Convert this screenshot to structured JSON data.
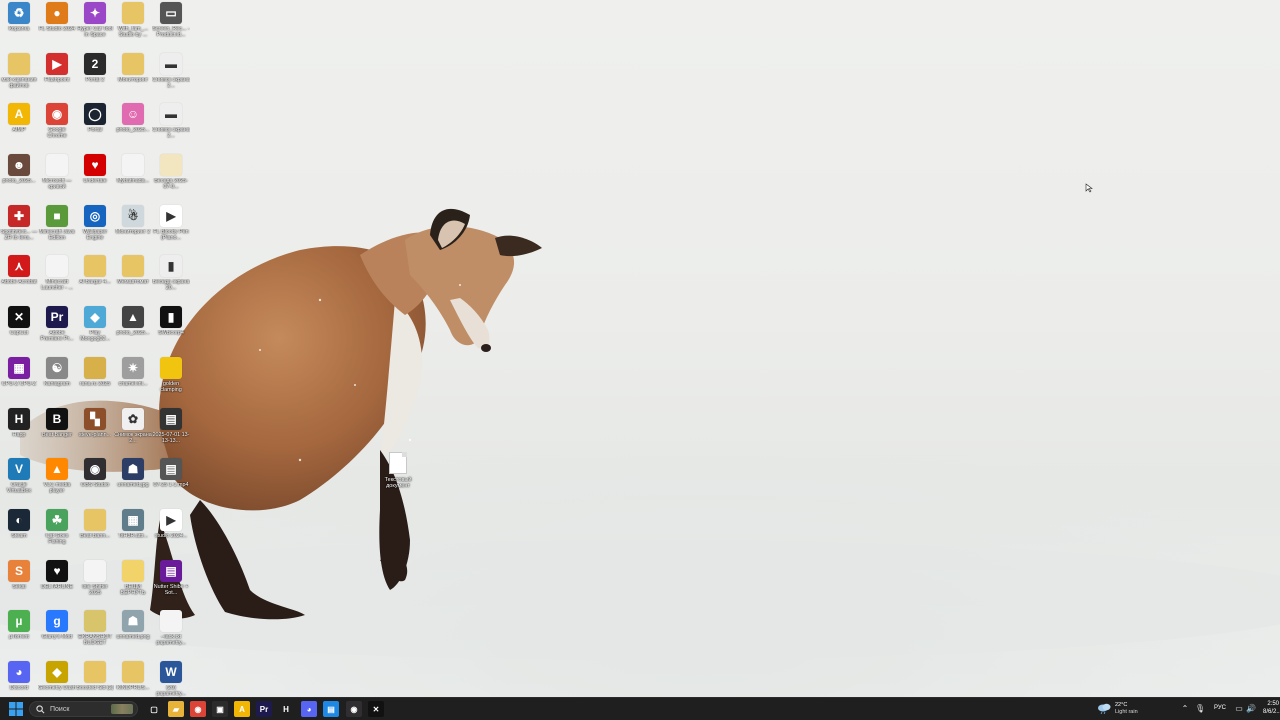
{
  "desktop": {
    "icons": [
      {
        "label": "Корзина",
        "glyph": "♻",
        "color": "#3a86c8"
      },
      {
        "label": "FL Studio 2024",
        "glyph": "●",
        "color": "#e07b1a"
      },
      {
        "label": "Hyper Cat Tool in Space",
        "glyph": "✦",
        "color": "#9b48c8"
      },
      {
        "label": "With_fam_... Studio by ...",
        "glyph": "",
        "color": "#e8c564"
      },
      {
        "label": "Screen_Rec... - Product.ld...",
        "glyph": "▭",
        "color": "#555555"
      },
      {
        "label": "мэй кампания файлов",
        "glyph": "",
        "color": "#e8c564"
      },
      {
        "label": "Flashpoint",
        "glyph": "▶",
        "color": "#d32f2f"
      },
      {
        "label": "Portal 2",
        "glyph": "2",
        "color": "#2b2b2b"
      },
      {
        "label": "Мониторинг",
        "glyph": "",
        "color": "#e8c564"
      },
      {
        "label": "Снимок экрана 2...",
        "glyph": "▬",
        "color": "#eeeeee"
      },
      {
        "label": "AIMP",
        "glyph": "A",
        "color": "#f2b705"
      },
      {
        "label": "Google Chrome",
        "glyph": "◉",
        "color": "#db4437"
      },
      {
        "label": "Portal",
        "glyph": "◯",
        "color": "#1b2430"
      },
      {
        "label": "photo_2025...",
        "glyph": "☺",
        "color": "#e06bb0"
      },
      {
        "label": "Снимок экрана 2...",
        "glyph": "▬",
        "color": "#eeeeee"
      },
      {
        "label": "photo_2025...",
        "glyph": "☻",
        "color": "#6a4a3c"
      },
      {
        "label": "Microsoft — кривой",
        "glyph": "",
        "color": "#f4f4f4"
      },
      {
        "label": "Undertale",
        "glyph": "♥",
        "color": "#d40000"
      },
      {
        "label": "Mybatinada...",
        "glyph": "",
        "color": "#f4f4f4"
      },
      {
        "label": "Беседа 2025-07-0...",
        "glyph": "",
        "color": "#f2e6c0"
      },
      {
        "label": "Spotifytext... — ZR to lens...",
        "glyph": "✚",
        "color": "#c62828"
      },
      {
        "label": "Minecraft Java Edition",
        "glyph": "■",
        "color": "#5a9a3a"
      },
      {
        "label": "Wallpaper Engine",
        "glyph": "◎",
        "color": "#1565c0"
      },
      {
        "label": "Мониторинг 2",
        "glyph": "☃",
        "color": "#cfd8dc"
      },
      {
        "label": "FL Bloody Pen (Piano...",
        "glyph": "▶",
        "color": "#ffffff"
      },
      {
        "label": "Adobe Acrobat",
        "glyph": "⋏",
        "color": "#d21a1a"
      },
      {
        "label": "Minecraft Launcher - ...",
        "glyph": "",
        "color": "#f4f4f4"
      },
      {
        "label": "Al Bargar 4...",
        "glyph": "",
        "color": "#e8c564"
      },
      {
        "label": "Мемавтомат",
        "glyph": "",
        "color": "#e8c564"
      },
      {
        "label": "Беседа экрана 20...",
        "glyph": "▮",
        "color": "#eeeeee"
      },
      {
        "label": "CapCut",
        "glyph": "✕",
        "color": "#111111"
      },
      {
        "label": "Adobe Premiere Pr...",
        "glyph": "Pr",
        "color": "#1e1a4d"
      },
      {
        "label": "Play Mongog02...",
        "glyph": "◆",
        "color": "#4fa9d6"
      },
      {
        "label": "photo_2025...",
        "glyph": "▲",
        "color": "#444444"
      },
      {
        "label": "SWBcorp4",
        "glyph": "▮",
        "color": "#111111"
      },
      {
        "label": "CPU-Z CPU-Z",
        "glyph": "▦",
        "color": "#7b1fa2"
      },
      {
        "label": "Kanlagram",
        "glyph": "☯",
        "color": "#888888"
      },
      {
        "label": "rana.ru 2025",
        "glyph": "",
        "color": "#d8b04a"
      },
      {
        "label": "chamel.lnl...",
        "glyph": "✷",
        "color": "#9e9e9e"
      },
      {
        "label": "golden clamping",
        "glyph": "",
        "color": "#f1c40f"
      },
      {
        "label": "Happ",
        "glyph": "H",
        "color": "#222222"
      },
      {
        "label": "Beat Banger",
        "glyph": "B",
        "color": "#111111"
      },
      {
        "label": "steve-plann...",
        "glyph": "▚",
        "color": "#8d4e2a"
      },
      {
        "label": "Снимок экрана 2...",
        "glyph": "✿",
        "color": "#f0f0f0"
      },
      {
        "label": "2025-07-01 13-13-13...",
        "glyph": "▤",
        "color": "#333333"
      },
      {
        "label": "Oracle VirtualBox",
        "glyph": "V",
        "color": "#1e7bb8"
      },
      {
        "label": "VLC media player",
        "glyph": "▲",
        "color": "#ff8800"
      },
      {
        "label": "OBS Studio",
        "glyph": "◉",
        "color": "#302e31"
      },
      {
        "label": "unnamed.jpg",
        "glyph": "☗",
        "color": "#2c3e66"
      },
      {
        "label": "07-25 1-1.mp4",
        "glyph": "▤",
        "color": "#555555"
      },
      {
        "label": "Steam",
        "glyph": "◐",
        "color": "#1b2838"
      },
      {
        "label": "Cat Goes Fishing",
        "glyph": "☘",
        "color": "#4aa35c"
      },
      {
        "label": "Beat Bann...",
        "glyph": "",
        "color": "#e8c564"
      },
      {
        "label": "TsH3R.attr...",
        "glyph": "▦",
        "color": "#607d8b"
      },
      {
        "label": "studio 2024...",
        "glyph": "▶",
        "color": "#ffffff"
      },
      {
        "label": "Sekai",
        "glyph": "S",
        "color": "#e8813a"
      },
      {
        "label": "DELTARUNE",
        "glyph": "♥",
        "color": "#111111"
      },
      {
        "label": "Isle Shifter 2025",
        "glyph": "",
        "color": "#f4f4f4"
      },
      {
        "label": "ВЕЩИ ВЕРНУТЬ",
        "glyph": "",
        "color": "#f1d36a"
      },
      {
        "label": "Nutter Shibe + Sot...",
        "glyph": "▤",
        "color": "#6a1b9a"
      },
      {
        "label": "µTorrent",
        "glyph": "µ",
        "color": "#4caf50"
      },
      {
        "label": "Glarry's Mod",
        "glyph": "g",
        "color": "#2979ff"
      },
      {
        "label": "EKRANSHOT BUDGET",
        "glyph": "",
        "color": "#d8c46a"
      },
      {
        "label": "unnamed.png",
        "glyph": "☗",
        "color": "#90a4ae"
      },
      {
        "label": "--lack.txt papametry...",
        "glyph": "",
        "color": "#f4f4f4"
      },
      {
        "label": "Discord",
        "glyph": "◕",
        "color": "#5865f2"
      },
      {
        "label": "Geometry Dash",
        "glyph": "◆",
        "color": "#c8a400"
      },
      {
        "label": "Boosted Sid (2)",
        "glyph": "",
        "color": "#e8c564"
      },
      {
        "label": "KINOPRUS...",
        "glyph": "",
        "color": "#e8c564"
      },
      {
        "label": "(20) papametry...",
        "glyph": "W",
        "color": "#2b579a"
      }
    ],
    "text_doc": {
      "label": "Текстовый документ"
    }
  },
  "taskbar": {
    "search_placeholder": "Поиск",
    "pinned": [
      {
        "name": "taskview",
        "glyph": "▢",
        "color": "#1f1f1f"
      },
      {
        "name": "explorer",
        "glyph": "▰",
        "color": "#e8b339"
      },
      {
        "name": "chrome",
        "glyph": "◉",
        "color": "#db4437"
      },
      {
        "name": "store",
        "glyph": "▣",
        "color": "#2b2b2b"
      },
      {
        "name": "aimp",
        "glyph": "A",
        "color": "#f2b705"
      },
      {
        "name": "premiere",
        "glyph": "Pr",
        "color": "#1e1a4d"
      },
      {
        "name": "happ",
        "glyph": "H",
        "color": "#1f1f1f"
      },
      {
        "name": "discord-app",
        "glyph": "◕",
        "color": "#5865f2"
      },
      {
        "name": "docs",
        "glyph": "▤",
        "color": "#1e88e5"
      },
      {
        "name": "obs",
        "glyph": "◉",
        "color": "#302e31"
      },
      {
        "name": "capcut",
        "glyph": "✕",
        "color": "#111111"
      }
    ],
    "weather": {
      "temp": "22°C",
      "condition": "Light rain"
    },
    "language": "РУС",
    "time": "2:50",
    "date": "8/6/2..."
  }
}
